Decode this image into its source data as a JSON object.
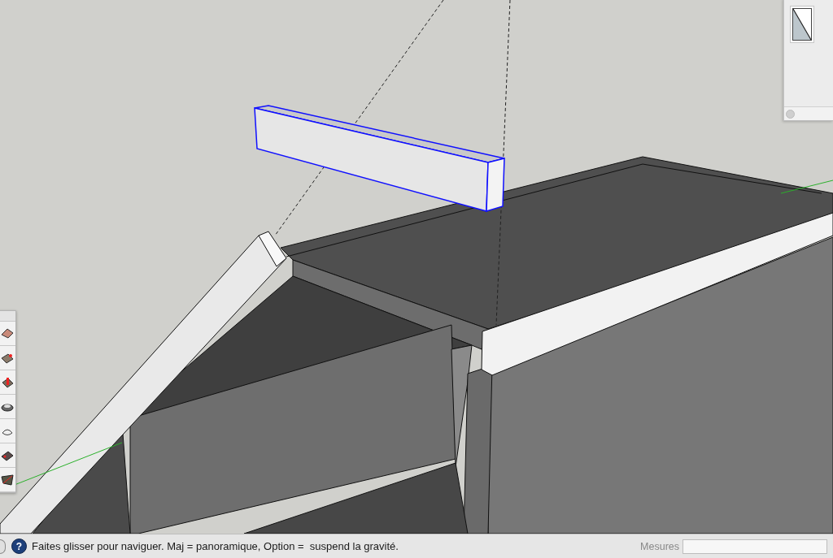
{
  "scene": {
    "beam": {
      "selected": true
    }
  },
  "status_bar": {
    "help_glyph": "?",
    "hint": "Faites glisser pour naviguer. Maj = panoramique, Option =  suspend la gravité.",
    "measurements_label": "Mesures"
  }
}
